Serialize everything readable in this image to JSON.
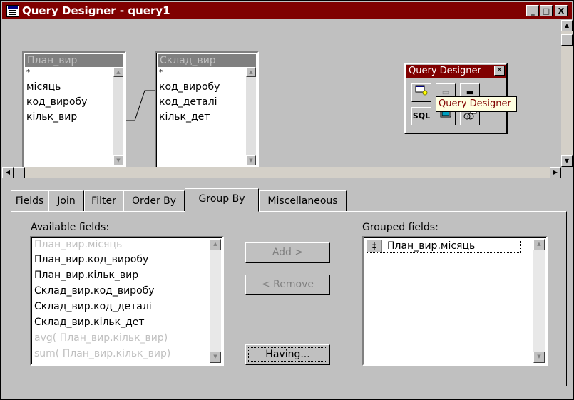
{
  "window": {
    "title": "Query Designer - query1",
    "controls": {
      "minimize": "_",
      "maximize": "□",
      "close": "X"
    }
  },
  "tables": [
    {
      "name": "План_вир",
      "fields": [
        "*",
        "місяць",
        "код_виробу",
        "кільк_вир"
      ]
    },
    {
      "name": "Склад_вир",
      "fields": [
        "*",
        "код_виробу",
        "код_деталі",
        "кільк_дет"
      ]
    }
  ],
  "palette": {
    "title": "Query Designer",
    "sql_label": "SQL",
    "tooltip": "Query Designer"
  },
  "tabs": [
    {
      "label": "Fields"
    },
    {
      "label": "Join"
    },
    {
      "label": "Filter"
    },
    {
      "label": "Order By"
    },
    {
      "label": "Group By"
    },
    {
      "label": "Miscellaneous"
    }
  ],
  "active_tab": "Group By",
  "group_by": {
    "available_label": "Available fields:",
    "available_items": [
      "План_вир.місяць",
      "План_вир.код_виробу",
      "План_вир.кільк_вир",
      "Склад_вир.код_виробу",
      "Склад_вир.код_деталі",
      "Склад_вир.кільк_дет",
      "avg( План_вир.кільк_вир)",
      "sum( План_вир.кільк_вир)"
    ],
    "add_label": "Add >",
    "remove_label": "< Remove",
    "having_label": "Having...",
    "grouped_label": "Grouped fields:",
    "grouped_items": [
      "План_вир.місяць"
    ],
    "grouped_marker": "‡"
  },
  "icons": [
    "app-icon",
    "table-icon",
    "sql-icon",
    "view-icon",
    "link-icon"
  ]
}
